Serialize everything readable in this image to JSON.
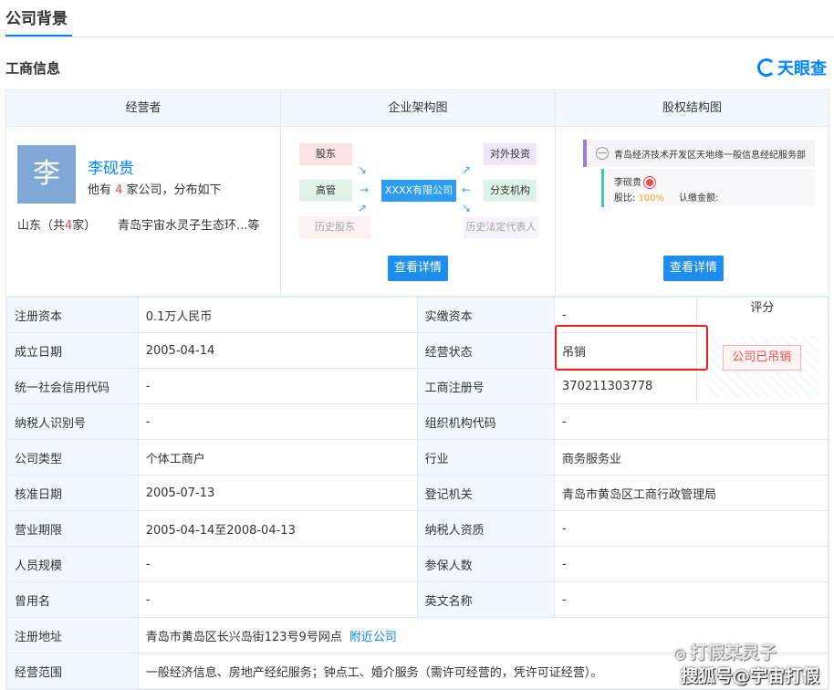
{
  "top_tab": "公司背景",
  "section_title": "工商信息",
  "logo_text": "天眼查",
  "header": {
    "col1": "经营者",
    "col2": "企业架构图",
    "col3": "股权结构图"
  },
  "operator": {
    "avatar_char": "李",
    "name": "李砚贵",
    "sub_prefix": "他有 ",
    "sub_count": "4",
    "sub_suffix": " 家公司，分布如下",
    "region_prefix": "山东（共",
    "region_count": "4",
    "region_suffix": "家）",
    "company": "青岛宇宙水灵子生态环...等"
  },
  "structure": {
    "shareholder": "股东",
    "manager": "高管",
    "history_shareholder": "历史股东",
    "center": "XXXX有限公司",
    "investment": "对外投资",
    "branch": "分支机构",
    "history_rep": "历史法定代表人",
    "button": "查看详情"
  },
  "equity": {
    "company": "青岛经济技术开发区天地缘一般信息经纪服务部",
    "person": "李砚贵",
    "ratio_label": "股比:",
    "ratio_value": "100%",
    "amount_label": "认缴金额:",
    "button": "查看详情",
    "collapse_symbol": "—"
  },
  "info_rows": [
    {
      "label1": "注册资本",
      "value1": "0.1万人民币",
      "label2": "实缴资本",
      "value2": "-"
    },
    {
      "label1": "成立日期",
      "value1": "2005-04-14",
      "label2": "经营状态",
      "value2": "吊销"
    },
    {
      "label1": "统一社会信用代码",
      "value1": "-",
      "label2": "工商注册号",
      "value2": "370211303778"
    },
    {
      "label1": "纳税人识别号",
      "value1": "-",
      "label2": "组织机构代码",
      "value2": "-"
    },
    {
      "label1": "公司类型",
      "value1": "个体工商户",
      "label2": "行业",
      "value2": "商务服务业"
    },
    {
      "label1": "核准日期",
      "value1": "2005-07-13",
      "label2": "登记机关",
      "value2": "青岛市黄岛区工商行政管理局"
    },
    {
      "label1": "营业期限",
      "value1": "2005-04-14至2008-04-13",
      "label2": "纳税人资质",
      "value2": "-"
    },
    {
      "label1": "人员规模",
      "value1": "-",
      "label2": "参保人数",
      "value2": "-"
    },
    {
      "label1": "曾用名",
      "value1": "-",
      "label2": "英文名称",
      "value2": "-"
    }
  ],
  "score_label": "评分",
  "score_stamp": "公司已吊销",
  "address": {
    "label": "注册地址",
    "value": "青岛市黄岛区长兴岛街123号9号网点",
    "link": "附近公司"
  },
  "scope": {
    "label": "经营范围",
    "value": "一般经济信息、房地产经纪服务；钟点工、婚介服务（需许可经营的，凭许可证经营）。"
  },
  "watermark": {
    "line1": "打假某灵子",
    "line2": "搜狐号@宇宙打假"
  },
  "colors": {
    "accent": "#0084ff",
    "highlight_red": "#ee1c1c",
    "header_bg": "#f2f8ff"
  }
}
